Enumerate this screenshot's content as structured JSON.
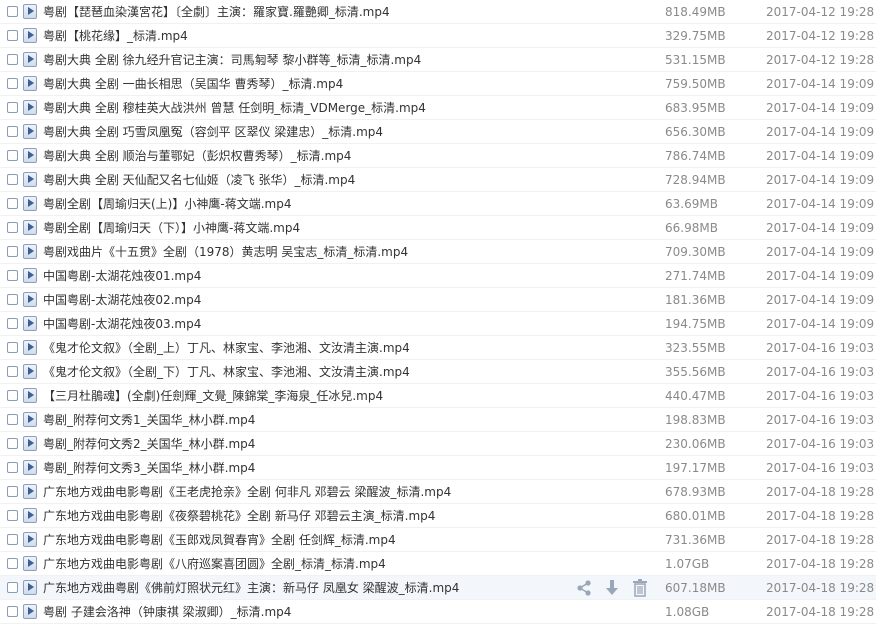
{
  "files": [
    {
      "name": "粤剧【琵琶血染漢宮花】〔全劇〕主演：羅家寶.羅艷卿_标清.mp4",
      "size": "818.49MB",
      "date": "2017-04-12 19:28"
    },
    {
      "name": "粤剧【桃花缘】_标清.mp4",
      "size": "329.75MB",
      "date": "2017-04-12 19:28"
    },
    {
      "name": "粤剧大典  全剧   徐九经升官记主演：司馬匑琴 黎小群等_标清_标清.mp4",
      "size": "531.15MB",
      "date": "2017-04-12 19:28"
    },
    {
      "name": "粤剧大典  全剧    一曲长相思（吴国华 曹秀琴）_标清.mp4",
      "size": "759.50MB",
      "date": "2017-04-14 19:09"
    },
    {
      "name": "粤剧大典  全剧  穆桂英大战洪州  曾慧  任剑明_标清_VDMerge_标清.mp4",
      "size": "683.95MB",
      "date": "2017-04-14 19:09"
    },
    {
      "name": "粤剧大典  全剧  巧雪凤凰冤（容剑平 区翠仪 梁建忠）_标清.mp4",
      "size": "656.30MB",
      "date": "2017-04-14 19:09"
    },
    {
      "name": "粤剧大典  全剧  顺治与董鄂妃（彭炽权曹秀琴）_标清.mp4",
      "size": "786.74MB",
      "date": "2017-04-14 19:09"
    },
    {
      "name": "粤剧大典  全剧  天仙配又名七仙姬（凌飞 张华）_标清.mp4",
      "size": "728.94MB",
      "date": "2017-04-14 19:09"
    },
    {
      "name": "粤剧全剧【周瑜归天(上)】小神鹰-蒋文端.mp4",
      "size": "63.69MB",
      "date": "2017-04-14 19:09"
    },
    {
      "name": "粤剧全剧【周瑜归天（下）】小神鹰-蒋文端.mp4",
      "size": "66.98MB",
      "date": "2017-04-14 19:09"
    },
    {
      "name": "粤剧戏曲片《十五贯》全剧（1978）黄志明 吴宝志_标清_标清.mp4",
      "size": "709.30MB",
      "date": "2017-04-14 19:09"
    },
    {
      "name": "中国粤剧-太湖花烛夜01.mp4",
      "size": "271.74MB",
      "date": "2017-04-14 19:09"
    },
    {
      "name": "中国粤剧-太湖花烛夜02.mp4",
      "size": "181.36MB",
      "date": "2017-04-14 19:09"
    },
    {
      "name": "中国粤剧-太湖花烛夜03.mp4",
      "size": "194.75MB",
      "date": "2017-04-14 19:09"
    },
    {
      "name": "《鬼才伦文叙》（全剧_上）丁凡、林家宝、李池湘、文汝清主演.mp4",
      "size": "323.55MB",
      "date": "2017-04-16 19:03"
    },
    {
      "name": "《鬼才伦文叙》（全剧_下）丁凡、林家宝、李池湘、文汝清主演.mp4",
      "size": "355.56MB",
      "date": "2017-04-16 19:03"
    },
    {
      "name": "【三月杜鵑魂】(全劇)任劍輝_文覺_陳錦棠_李海泉_任冰兒.mp4",
      "size": "440.47MB",
      "date": "2017-04-16 19:03"
    },
    {
      "name": "粤剧_附荐何文秀1_关国华_林小群.mp4",
      "size": "198.83MB",
      "date": "2017-04-16 19:03"
    },
    {
      "name": "粤剧_附荐何文秀2_关国华_林小群.mp4",
      "size": "230.06MB",
      "date": "2017-04-16 19:03"
    },
    {
      "name": "粤剧_附荐何文秀3_关国华_林小群.mp4",
      "size": "197.17MB",
      "date": "2017-04-16 19:03"
    },
    {
      "name": "广东地方戏曲电影粤剧《王老虎抢亲》全剧 何非凡 邓碧云 梁醒波_标清.mp4",
      "size": "678.93MB",
      "date": "2017-04-18 19:28"
    },
    {
      "name": "广东地方戏曲电影粤剧《夜祭碧桃花》全剧 新马仔 邓碧云主演_标清.mp4",
      "size": "680.01MB",
      "date": "2017-04-18 19:28"
    },
    {
      "name": "广东地方戏曲电影粤剧《玉郎戏凤賀春宵》全剧 任剑辉_标清.mp4",
      "size": "731.36MB",
      "date": "2017-04-18 19:28"
    },
    {
      "name": "广东地方戏曲电影粤剧《八府巡案喜团圆》全剧_标清_标清.mp4",
      "size": "1.07GB",
      "date": "2017-04-18 19:28"
    },
    {
      "name": "广东地方戏曲粤剧《佛前灯照状元红》主演：新马仔 凤凰女 梁醒波_标清.mp4",
      "size": "607.18MB",
      "date": "2017-04-18 19:28",
      "hovered": true
    },
    {
      "name": "粤剧  子建会洛神（钟康祺 梁淑卿）_标清.mp4",
      "size": "1.08GB",
      "date": "2017-04-18 19:28"
    }
  ],
  "row_actions": [
    "share-icon",
    "download-icon",
    "delete-icon"
  ],
  "colors": {
    "row_hover_bg": "#f3f6fa",
    "meta_text": "#8a8a8a",
    "name_text": "#333333",
    "action_icon": "#9aa7b8",
    "file_icon": "#3d5f96"
  }
}
